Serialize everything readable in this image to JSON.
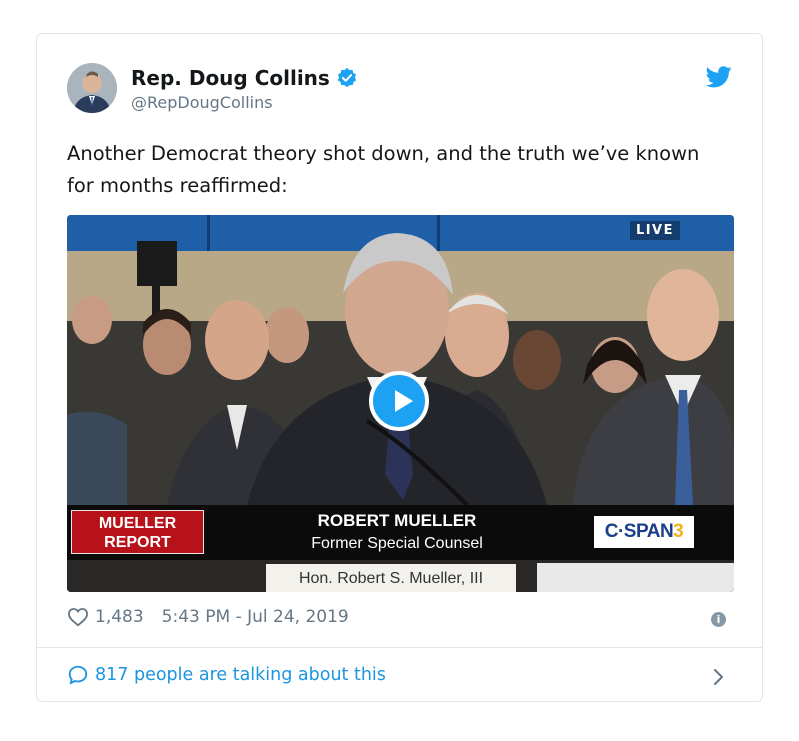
{
  "tweet": {
    "display_name": "Rep. Doug Collins",
    "handle": "@RepDougCollins",
    "text": "Another Democrat theory shot down, and the truth we’ve known for months reaffirmed:",
    "likes": "1,483",
    "timestamp": "5:43 PM - Jul 24, 2019",
    "talking": "817 people are talking about this",
    "accent_color": "#1da1f2",
    "verified_icon": "verified-badge-icon",
    "brand_icon": "twitter-bird-icon"
  },
  "video": {
    "live_label": "LIVE",
    "chyron_tag": "MUELLER REPORT",
    "chyron_name": "ROBERT MUELLER",
    "chyron_title": "Former Special Counsel",
    "network_logo": "C·SPAN",
    "network_logo_num": "3",
    "nameplate": "Hon. Robert S. Mueller, III",
    "play_icon": "play-icon"
  }
}
